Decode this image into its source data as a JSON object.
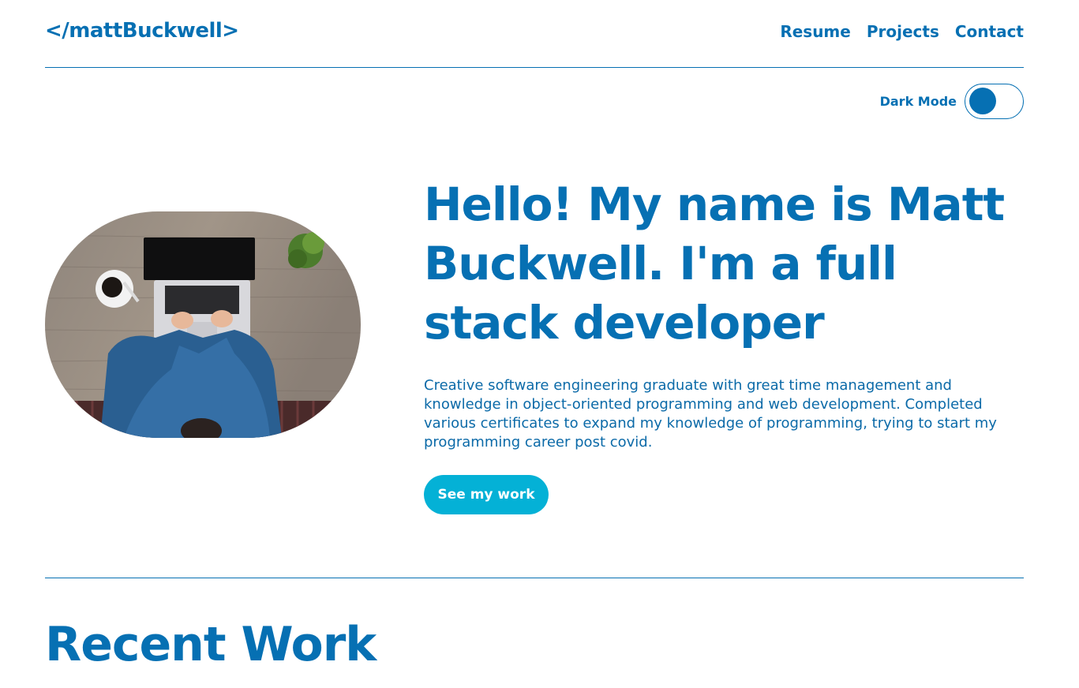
{
  "header": {
    "logo": "</mattBuckwell>",
    "nav": [
      {
        "label": "Resume"
      },
      {
        "label": "Projects"
      },
      {
        "label": "Contact"
      }
    ]
  },
  "dark_mode": {
    "label": "Dark Mode",
    "enabled": false
  },
  "hero": {
    "heading": "Hello! My name is Matt Buckwell. I'm a full stack developer",
    "description": "Creative software engineering graduate with great time management and knowledge in object-oriented programming and web development. Completed various certificates to expand my knowledge of programming, trying to start my programming career post covid.",
    "cta_label": "See my work"
  },
  "recent_work": {
    "title": "Recent Work"
  },
  "colors": {
    "primary": "#0670b3",
    "cta": "#04b1d6",
    "background": "#ffffff"
  }
}
